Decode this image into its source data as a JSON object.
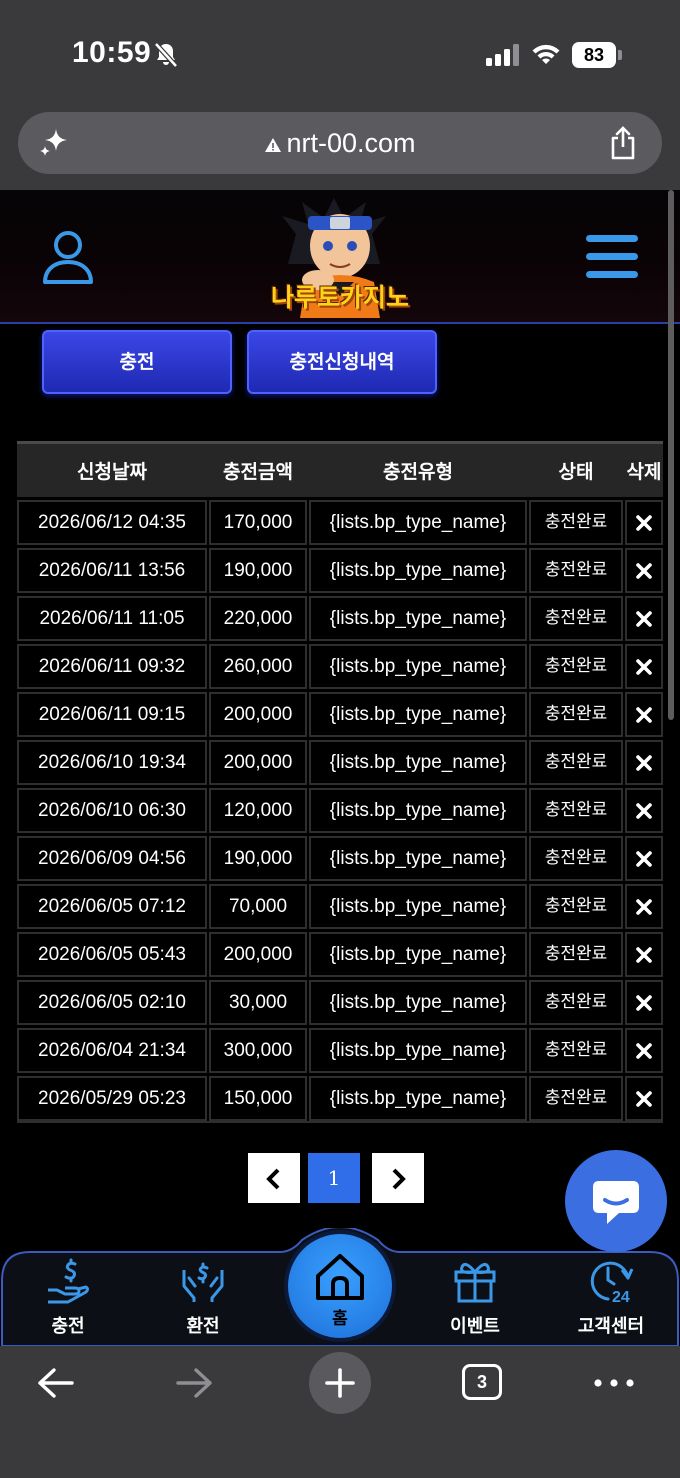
{
  "status_bar": {
    "time": "10:59",
    "battery": "83"
  },
  "browser": {
    "url": "nrt-00.com",
    "tab_count": "3"
  },
  "site": {
    "logo_text": "나루토카지노",
    "tabs": [
      {
        "label": "충전"
      },
      {
        "label": "충전신청내역"
      }
    ]
  },
  "table": {
    "headers": [
      "신청날짜",
      "충전금액",
      "충전유형",
      "상태",
      "삭제"
    ],
    "rows": [
      [
        "2026/06/12 04:35",
        "170,000",
        "{lists.bp_type_name}",
        "충전완료"
      ],
      [
        "2026/06/11 13:56",
        "190,000",
        "{lists.bp_type_name}",
        "충전완료"
      ],
      [
        "2026/06/11 11:05",
        "220,000",
        "{lists.bp_type_name}",
        "충전완료"
      ],
      [
        "2026/06/11 09:32",
        "260,000",
        "{lists.bp_type_name}",
        "충전완료"
      ],
      [
        "2026/06/11 09:15",
        "200,000",
        "{lists.bp_type_name}",
        "충전완료"
      ],
      [
        "2026/06/10 19:34",
        "200,000",
        "{lists.bp_type_name}",
        "충전완료"
      ],
      [
        "2026/06/10 06:30",
        "120,000",
        "{lists.bp_type_name}",
        "충전완료"
      ],
      [
        "2026/06/09 04:56",
        "190,000",
        "{lists.bp_type_name}",
        "충전완료"
      ],
      [
        "2026/06/05 07:12",
        "70,000",
        "{lists.bp_type_name}",
        "충전완료"
      ],
      [
        "2026/06/05 05:43",
        "200,000",
        "{lists.bp_type_name}",
        "충전완료"
      ],
      [
        "2026/06/05 02:10",
        "30,000",
        "{lists.bp_type_name}",
        "충전완료"
      ],
      [
        "2026/06/04 21:34",
        "300,000",
        "{lists.bp_type_name}",
        "충전완료"
      ],
      [
        "2026/05/29 05:23",
        "150,000",
        "{lists.bp_type_name}",
        "충전완료"
      ]
    ]
  },
  "pagination": {
    "current": "1"
  },
  "bottom_nav": {
    "items": [
      {
        "label": "충전",
        "icon": "deposit-icon"
      },
      {
        "label": "환전",
        "icon": "withdraw-icon"
      },
      {
        "label": "홈",
        "icon": "home-icon"
      },
      {
        "label": "이벤트",
        "icon": "gift-icon"
      },
      {
        "label": "고객센터",
        "icon": "support-24-icon"
      }
    ]
  },
  "colors": {
    "accent_blue": "#2f6ee8",
    "tab_blue": "#2a36cf",
    "chat_blue": "#3b6ee0"
  }
}
